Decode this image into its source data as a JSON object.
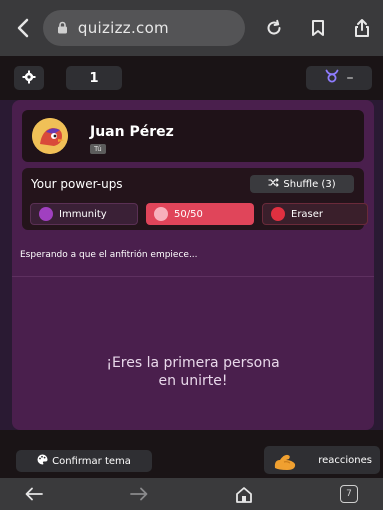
{
  "browser": {
    "url": "quizizz.com",
    "tabs_count": "7"
  },
  "quiz_header": {
    "question_count": "1",
    "theme_dash": "–"
  },
  "user": {
    "name": "Juan Pérez",
    "tag": "Tú"
  },
  "powerups": {
    "title": "Your power-ups",
    "shuffle_label": "Shuffle (3)",
    "items": [
      {
        "label": "Immunity",
        "color": "#a040c0"
      },
      {
        "label": "50/50",
        "color": "#f08a9a"
      },
      {
        "label": "Eraser",
        "color": "#e03040"
      }
    ]
  },
  "status": {
    "waiting": "Esperando a que el anfitrión empiece...",
    "first_line1": "¡Eres la primera persona",
    "first_line2": "en unirte!"
  },
  "actions": {
    "confirm_theme": "Confirmar tema",
    "reactions": "reacciones"
  },
  "colors": {
    "panel": "#4a1f4d",
    "accent_5050": "#e0455a",
    "theme_icon": "#8e7cff"
  }
}
